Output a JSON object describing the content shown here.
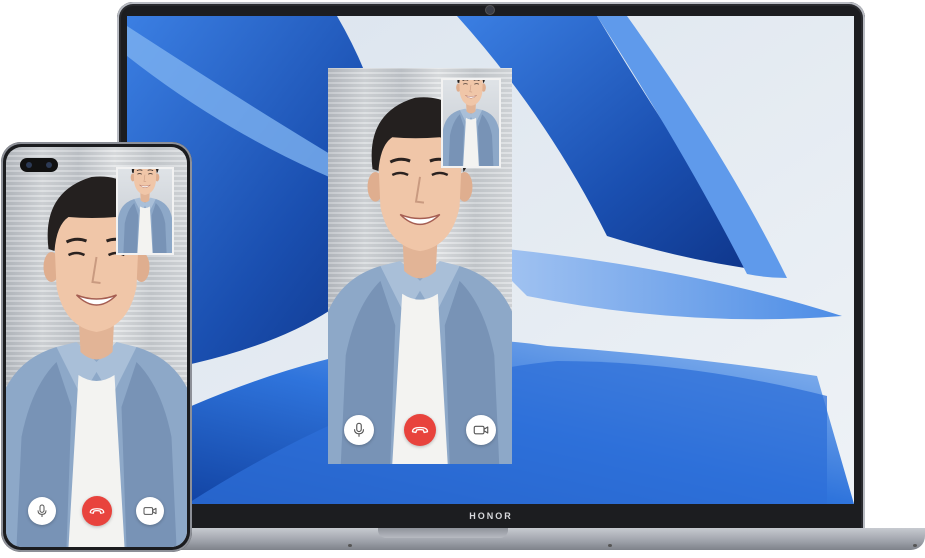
{
  "laptop": {
    "brand": "HONOR",
    "wallpaper": {
      "colors": [
        "#1b4ea8",
        "#3f7fe0",
        "#8fb5ec",
        "#e9eef4"
      ]
    }
  },
  "desktop_call_window": {
    "controls": [
      {
        "name": "mute",
        "icon": "microphone-icon"
      },
      {
        "name": "hang-up",
        "icon": "phone-hangup-icon",
        "color": "#e8433d"
      },
      {
        "name": "video",
        "icon": "video-camera-icon"
      }
    ]
  },
  "phone_call_screen": {
    "controls": [
      {
        "name": "mute",
        "icon": "microphone-icon"
      },
      {
        "name": "hang-up",
        "icon": "phone-hangup-icon",
        "color": "#e8433d"
      },
      {
        "name": "video",
        "icon": "video-camera-icon"
      }
    ]
  }
}
